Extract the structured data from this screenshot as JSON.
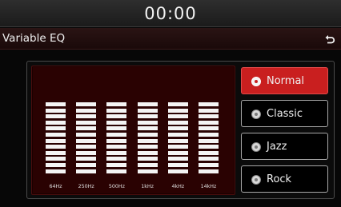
{
  "status_bar": {
    "clock": "00:00"
  },
  "title_bar": {
    "title": "Variable EQ",
    "back_icon": "back-arrow-icon"
  },
  "equalizer": {
    "bands": [
      {
        "label": "64Hz",
        "level_segments": 12
      },
      {
        "label": "250Hz",
        "level_segments": 12
      },
      {
        "label": "500Hz",
        "level_segments": 12
      },
      {
        "label": "1kHz",
        "level_segments": 12
      },
      {
        "label": "4kHz",
        "level_segments": 12
      },
      {
        "label": "14kHz",
        "level_segments": 12
      }
    ]
  },
  "presets": [
    {
      "label": "Normal",
      "selected": true
    },
    {
      "label": "Classic",
      "selected": false
    },
    {
      "label": "Jazz",
      "selected": false
    },
    {
      "label": "Rock",
      "selected": false
    }
  ],
  "colors": {
    "accent": "#c91f1f",
    "eq_panel_background": "#2a0202",
    "segment": "#f4f4f4"
  }
}
